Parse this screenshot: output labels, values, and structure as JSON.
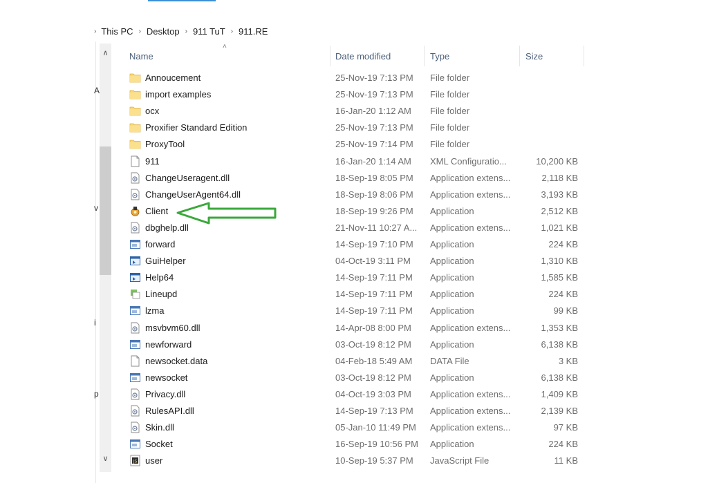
{
  "breadcrumb": {
    "items": [
      "This PC",
      "Desktop",
      "911 TuT",
      "911.RE"
    ]
  },
  "left_fragments": [
    "A",
    "v",
    "i",
    "p"
  ],
  "scroll": {
    "up": "∧",
    "down": "∨"
  },
  "columns": {
    "name": "Name",
    "date": "Date modified",
    "type": "Type",
    "size": "Size"
  },
  "files": [
    {
      "name": "Annoucement",
      "date": "25-Nov-19 7:13 PM",
      "type": "File folder",
      "size": "",
      "icon": "folder-icon"
    },
    {
      "name": "import examples",
      "date": "25-Nov-19 7:13 PM",
      "type": "File folder",
      "size": "",
      "icon": "folder-icon"
    },
    {
      "name": "ocx",
      "date": "16-Jan-20 1:12 AM",
      "type": "File folder",
      "size": "",
      "icon": "folder-icon"
    },
    {
      "name": "Proxifier Standard Edition",
      "date": "25-Nov-19 7:13 PM",
      "type": "File folder",
      "size": "",
      "icon": "folder-icon"
    },
    {
      "name": "ProxyTool",
      "date": "25-Nov-19 7:14 PM",
      "type": "File folder",
      "size": "",
      "icon": "folder-icon"
    },
    {
      "name": "911",
      "date": "16-Jan-20 1:14 AM",
      "type": "XML Configuratio...",
      "size": "10,200 KB",
      "icon": "document-icon"
    },
    {
      "name": "ChangeUseragent.dll",
      "date": "18-Sep-19 8:05 PM",
      "type": "Application extens...",
      "size": "2,118 KB",
      "icon": "dll-icon"
    },
    {
      "name": "ChangeUserAgent64.dll",
      "date": "18-Sep-19 8:06 PM",
      "type": "Application extens...",
      "size": "3,193 KB",
      "icon": "dll-icon"
    },
    {
      "name": "Client",
      "date": "18-Sep-19 9:26 PM",
      "type": "Application",
      "size": "2,512 KB",
      "icon": "client-app-icon"
    },
    {
      "name": "dbghelp.dll",
      "date": "21-Nov-11 10:27 A...",
      "type": "Application extens...",
      "size": "1,021 KB",
      "icon": "dll-icon"
    },
    {
      "name": "forward",
      "date": "14-Sep-19 7:10 PM",
      "type": "Application",
      "size": "224 KB",
      "icon": "app-window-icon"
    },
    {
      "name": "GuiHelper",
      "date": "04-Oct-19 3:11 PM",
      "type": "Application",
      "size": "1,310 KB",
      "icon": "app-blue-icon"
    },
    {
      "name": "Help64",
      "date": "14-Sep-19 7:11 PM",
      "type": "Application",
      "size": "1,585 KB",
      "icon": "app-blue-icon"
    },
    {
      "name": "Lineupd",
      "date": "14-Sep-19 7:11 PM",
      "type": "Application",
      "size": "224 KB",
      "icon": "green-app-icon"
    },
    {
      "name": "lzma",
      "date": "14-Sep-19 7:11 PM",
      "type": "Application",
      "size": "99 KB",
      "icon": "app-window-icon"
    },
    {
      "name": "msvbvm60.dll",
      "date": "14-Apr-08 8:00 PM",
      "type": "Application extens...",
      "size": "1,353 KB",
      "icon": "dll-icon"
    },
    {
      "name": "newforward",
      "date": "03-Oct-19 8:12 PM",
      "type": "Application",
      "size": "6,138 KB",
      "icon": "app-window-icon"
    },
    {
      "name": "newsocket.data",
      "date": "04-Feb-18 5:49 AM",
      "type": "DATA File",
      "size": "3 KB",
      "icon": "document-icon"
    },
    {
      "name": "newsocket",
      "date": "03-Oct-19 8:12 PM",
      "type": "Application",
      "size": "6,138 KB",
      "icon": "app-window-icon"
    },
    {
      "name": "Privacy.dll",
      "date": "04-Oct-19 3:03 PM",
      "type": "Application extens...",
      "size": "1,409 KB",
      "icon": "dll-icon"
    },
    {
      "name": "RulesAPI.dll",
      "date": "14-Sep-19 7:13 PM",
      "type": "Application extens...",
      "size": "2,139 KB",
      "icon": "dll-icon"
    },
    {
      "name": "Skin.dll",
      "date": "05-Jan-10 11:49 PM",
      "type": "Application extens...",
      "size": "97 KB",
      "icon": "dll-icon"
    },
    {
      "name": "Socket",
      "date": "16-Sep-19 10:56 PM",
      "type": "Application",
      "size": "224 KB",
      "icon": "app-window-icon"
    },
    {
      "name": "user",
      "date": "10-Sep-19 5:37 PM",
      "type": "JavaScript File",
      "size": "11 KB",
      "icon": "javascript-file-icon"
    }
  ],
  "colors": {
    "folder": "#f8d775",
    "folder_dark": "#e0b24a",
    "annotation_arrow": "#3aa83a",
    "accent": "#3c8fd6"
  }
}
